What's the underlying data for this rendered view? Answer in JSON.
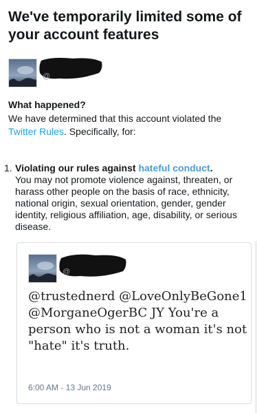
{
  "header": {
    "title": "We've temporarily limited some of your account features"
  },
  "account": {
    "avatar_icon": "profile-photo-sky",
    "handle_prefix": "@"
  },
  "notice": {
    "heading": "What happened?",
    "text_before": "We have determined that this account violated the ",
    "rules_link": "Twitter Rules",
    "text_after": ". Specifically, for:"
  },
  "violations": [
    {
      "number": "1.",
      "title": "Violating our rules against ",
      "link": "hateful conduct",
      "title_suffix": ".",
      "description": "You may not promote violence against, threaten, or harass other people on the basis of race, ethnicity, national origin, sexual orientation, gender, gender identity, religious affiliation, age, disability, or serious disease."
    }
  ],
  "tweet": {
    "handle_prefix": "@",
    "text": "@trustednerd @LoveOnlyBeGone1 @MorganeOgerBC JY You're a person who is not a woman it's not \"hate\" it's truth.",
    "timestamp": "6:00 AM - 13 Jun 2019"
  },
  "colors": {
    "link": "#1da1f2",
    "text": "#14171a",
    "muted": "#657786"
  }
}
